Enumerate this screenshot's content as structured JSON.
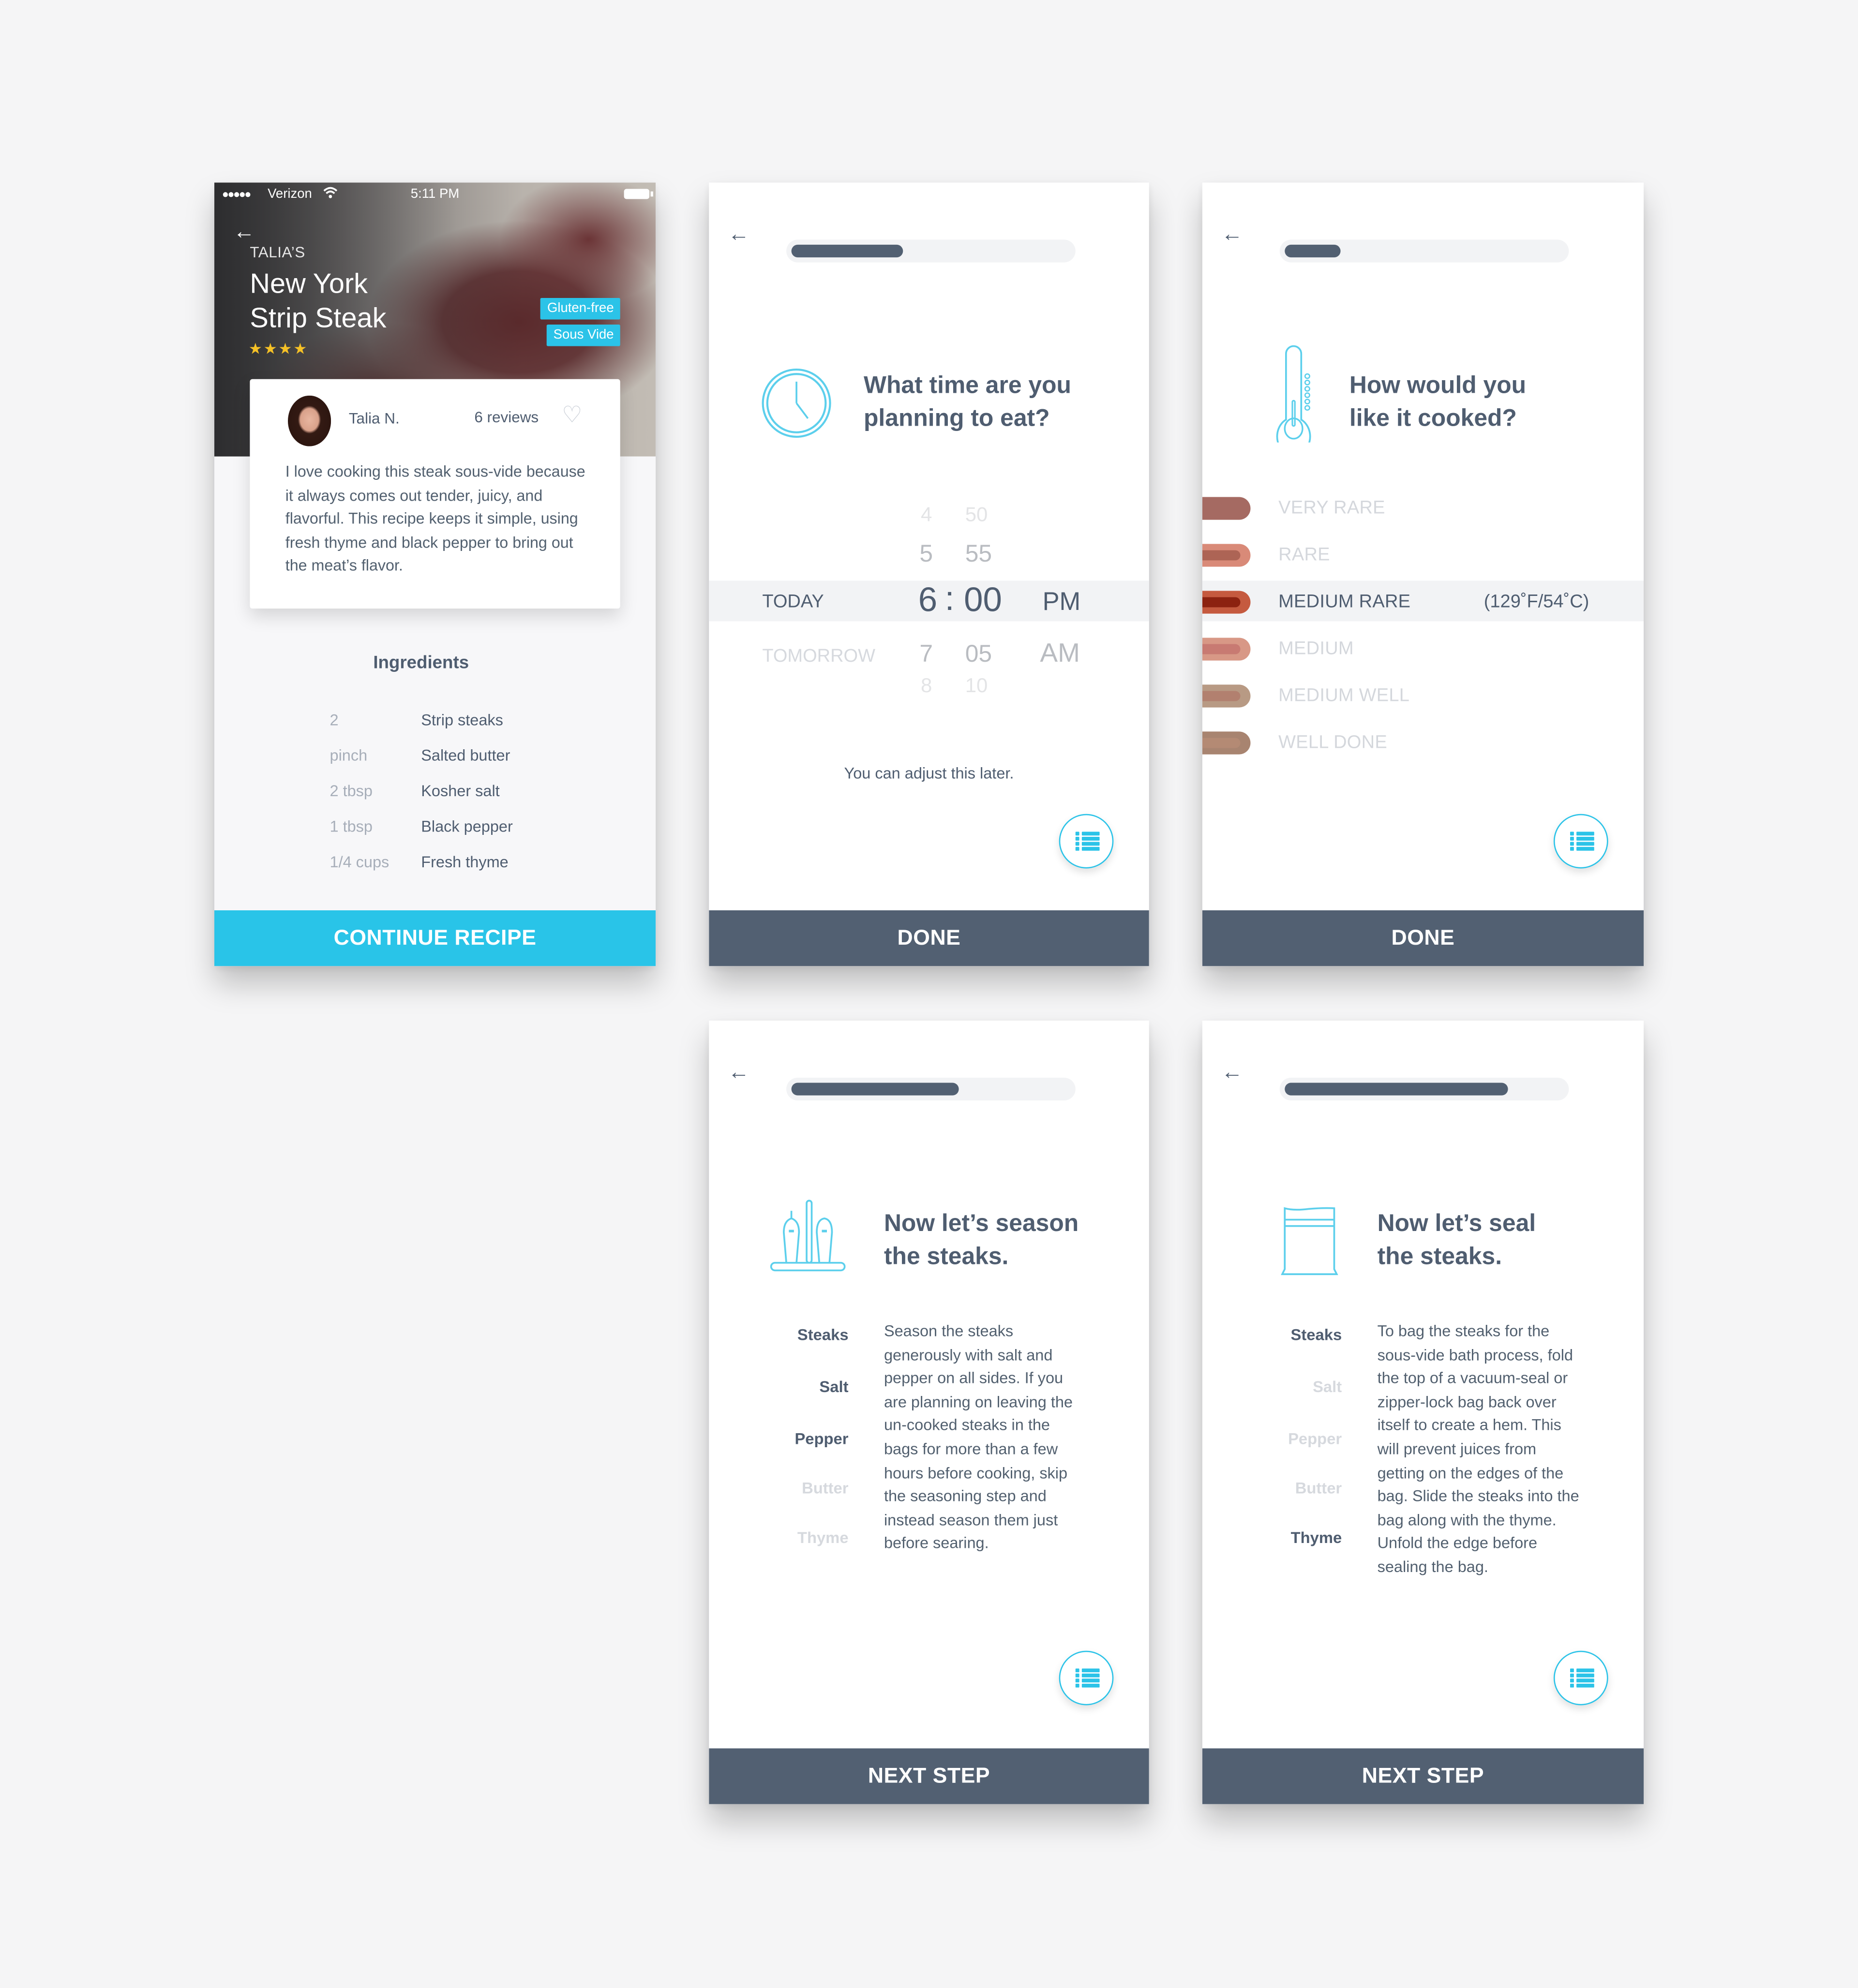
{
  "colors": {
    "accent_blue": "#29c4e8",
    "slate": "#526072",
    "text_slate": "#4f5d70",
    "muted": "#a7aeb9",
    "disabled": "#d6d9de",
    "star": "#f6c126",
    "page_bg": "#f5f5f6"
  },
  "recipe_screen": {
    "status_bar": {
      "signal": "●●●●●",
      "carrier": "Verizon",
      "wifi_icon": "wifi-icon",
      "time": "5:11 PM",
      "battery_icon": "battery-full-icon"
    },
    "back_icon": "←",
    "owner": "TALIA’S",
    "title_line1": "New York",
    "title_line2": "Strip Steak",
    "rating": {
      "value": 4,
      "max": 4,
      "glyphs": "★★★★"
    },
    "tags": [
      "Gluten-free",
      "Sous Vide"
    ],
    "review": {
      "author": "Talia N.",
      "review_count": "6 reviews",
      "heart_icon": "♡",
      "text": "I love cooking this steak sous-vide because it always comes out tender, juicy, and flavorful. This recipe keeps it simple, using fresh thyme and black pepper to bring out the meat’s flavor."
    },
    "ingredients_title": "Ingredients",
    "ingredients": [
      {
        "qty": "2",
        "name": "Strip steaks"
      },
      {
        "qty": "pinch",
        "name": "Salted butter"
      },
      {
        "qty": "2 tbsp",
        "name": "Kosher salt"
      },
      {
        "qty": "1 tbsp",
        "name": "Black pepper"
      },
      {
        "qty": "1/4 cups",
        "name": "Fresh thyme"
      }
    ],
    "cta_label": "CONTINUE RECIPE"
  },
  "time_screen": {
    "back_icon": "←",
    "progress": 0.4,
    "question_line1": "What time are you",
    "question_line2": "planning to eat?",
    "picker": {
      "days": {
        "selected": "TODAY",
        "next": "TOMORROW"
      },
      "hours": {
        "above2": "4",
        "above1": "5",
        "selected": "6",
        "below1": "7",
        "below2": "8"
      },
      "separator": ":",
      "minutes": {
        "above2": "50",
        "above1": "55",
        "selected": "00",
        "below1": "05",
        "below2": "10"
      },
      "period": {
        "selected": "PM",
        "next": "AM"
      }
    },
    "note": "You can adjust this later.",
    "list_button_icon": "list-icon",
    "cta_label": "DONE"
  },
  "doneness_screen": {
    "back_icon": "←",
    "progress": 0.2,
    "question_line1": "How would you",
    "question_line2": "like it cooked?",
    "options": [
      {
        "label": "VERY RARE",
        "outer": "#a56a62",
        "inner": "#a56a62",
        "selected": false
      },
      {
        "label": "RARE",
        "outer": "#d98a78",
        "inner": "#ad6455",
        "selected": false
      },
      {
        "label": "MEDIUM RARE",
        "outer": "#c55a3f",
        "inner": "#8c2210",
        "selected": true,
        "temp": "(129˚F/54˚C)"
      },
      {
        "label": "MEDIUM",
        "outer": "#d89886",
        "inner": "#c87a72",
        "selected": false
      },
      {
        "label": "MEDIUM WELL",
        "outer": "#b89a84",
        "inner": "#b2806f",
        "selected": false
      },
      {
        "label": "WELL DONE",
        "outer": "#a88470",
        "inner": "#b48a74",
        "selected": false
      }
    ],
    "list_button_icon": "list-icon",
    "cta_label": "DONE"
  },
  "season_screen": {
    "back_icon": "←",
    "progress": 0.6,
    "heading_line1": "Now let’s season",
    "heading_line2": "the steaks.",
    "ingredients": [
      {
        "name": "Steaks",
        "active": true
      },
      {
        "name": "Salt",
        "active": true
      },
      {
        "name": "Pepper",
        "active": true
      },
      {
        "name": "Butter",
        "active": false
      },
      {
        "name": "Thyme",
        "active": false
      }
    ],
    "instructions": "Season the steaks generously with salt and pepper on all sides. If you are planning on leaving the un-cooked steaks in the bags for more than a few hours before cooking, skip the seasoning step and instead season them just before searing.",
    "list_button_icon": "list-icon",
    "cta_label": "NEXT STEP"
  },
  "seal_screen": {
    "back_icon": "←",
    "progress": 0.8,
    "heading_line1": "Now let’s seal",
    "heading_line2": "the steaks.",
    "ingredients": [
      {
        "name": "Steaks",
        "active": true
      },
      {
        "name": "Salt",
        "active": false
      },
      {
        "name": "Pepper",
        "active": false
      },
      {
        "name": "Butter",
        "active": false
      },
      {
        "name": "Thyme",
        "active": true
      }
    ],
    "instructions": "To bag the steaks for the sous-vide bath process, fold the top of a vacuum-seal or zipper-lock bag back over itself to create a hem. This will prevent juices from getting on the edges of the bag. Slide the steaks into the bag along with the thyme. Unfold the edge before sealing the bag.",
    "list_button_icon": "list-icon",
    "cta_label": "NEXT STEP"
  }
}
